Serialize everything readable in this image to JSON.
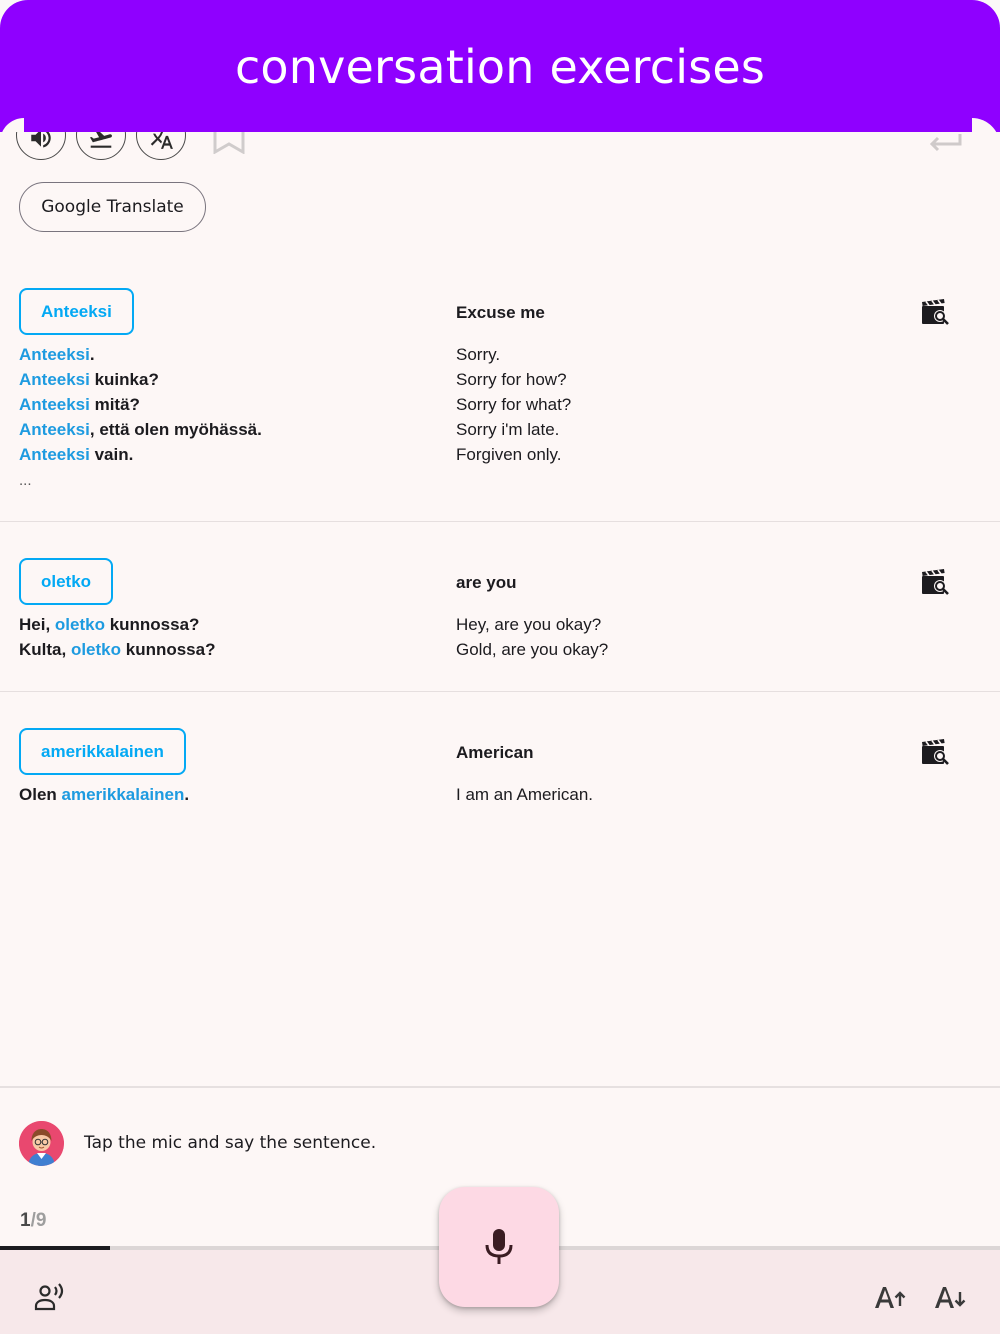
{
  "header": {
    "title": "conversation exercises"
  },
  "toolbar": {
    "icons": [
      "volume-icon",
      "flight-icon",
      "translate-icon",
      "bookmark-icon",
      "enter-icon"
    ],
    "google_translate_label": "Google Translate"
  },
  "items": [
    {
      "word": "Anteeksi",
      "translation": "Excuse me",
      "examples": [
        {
          "highlight": "Anteeksi",
          "rest": ".",
          "translation": "Sorry."
        },
        {
          "highlight": "Anteeksi",
          "rest": " kuinka?",
          "translation": "Sorry for how?"
        },
        {
          "highlight": "Anteeksi",
          "rest": " mitä?",
          "translation": "Sorry for what?"
        },
        {
          "highlight": "Anteeksi",
          "rest": ", että olen myöhässä.",
          "translation": "Sorry i'm late."
        },
        {
          "highlight": "Anteeksi",
          "rest": " vain.",
          "translation": "Forgiven only."
        }
      ],
      "more": "..."
    },
    {
      "word": "oletko",
      "translation": "are you",
      "examples": [
        {
          "pre": "Hei, ",
          "highlight": "oletko",
          "rest": " kunnossa?",
          "translation": "Hey, are you okay?"
        },
        {
          "pre": "Kulta, ",
          "highlight": "oletko",
          "rest": " kunnossa?",
          "translation": "Gold, are you okay?"
        }
      ]
    },
    {
      "word": "amerikkalainen",
      "translation": "American",
      "examples": [
        {
          "pre": "Olen ",
          "highlight": "amerikkalainen",
          "rest": ".",
          "translation": "I am an American."
        }
      ]
    }
  ],
  "assistant": {
    "prompt": "Tap the mic and say the sentence."
  },
  "progress": {
    "current": "1",
    "total": "/9",
    "fraction": 0.11
  },
  "colors": {
    "header": "#8f00ff",
    "accent": "#03a9f4",
    "mic_bg": "#fdd9e4"
  }
}
